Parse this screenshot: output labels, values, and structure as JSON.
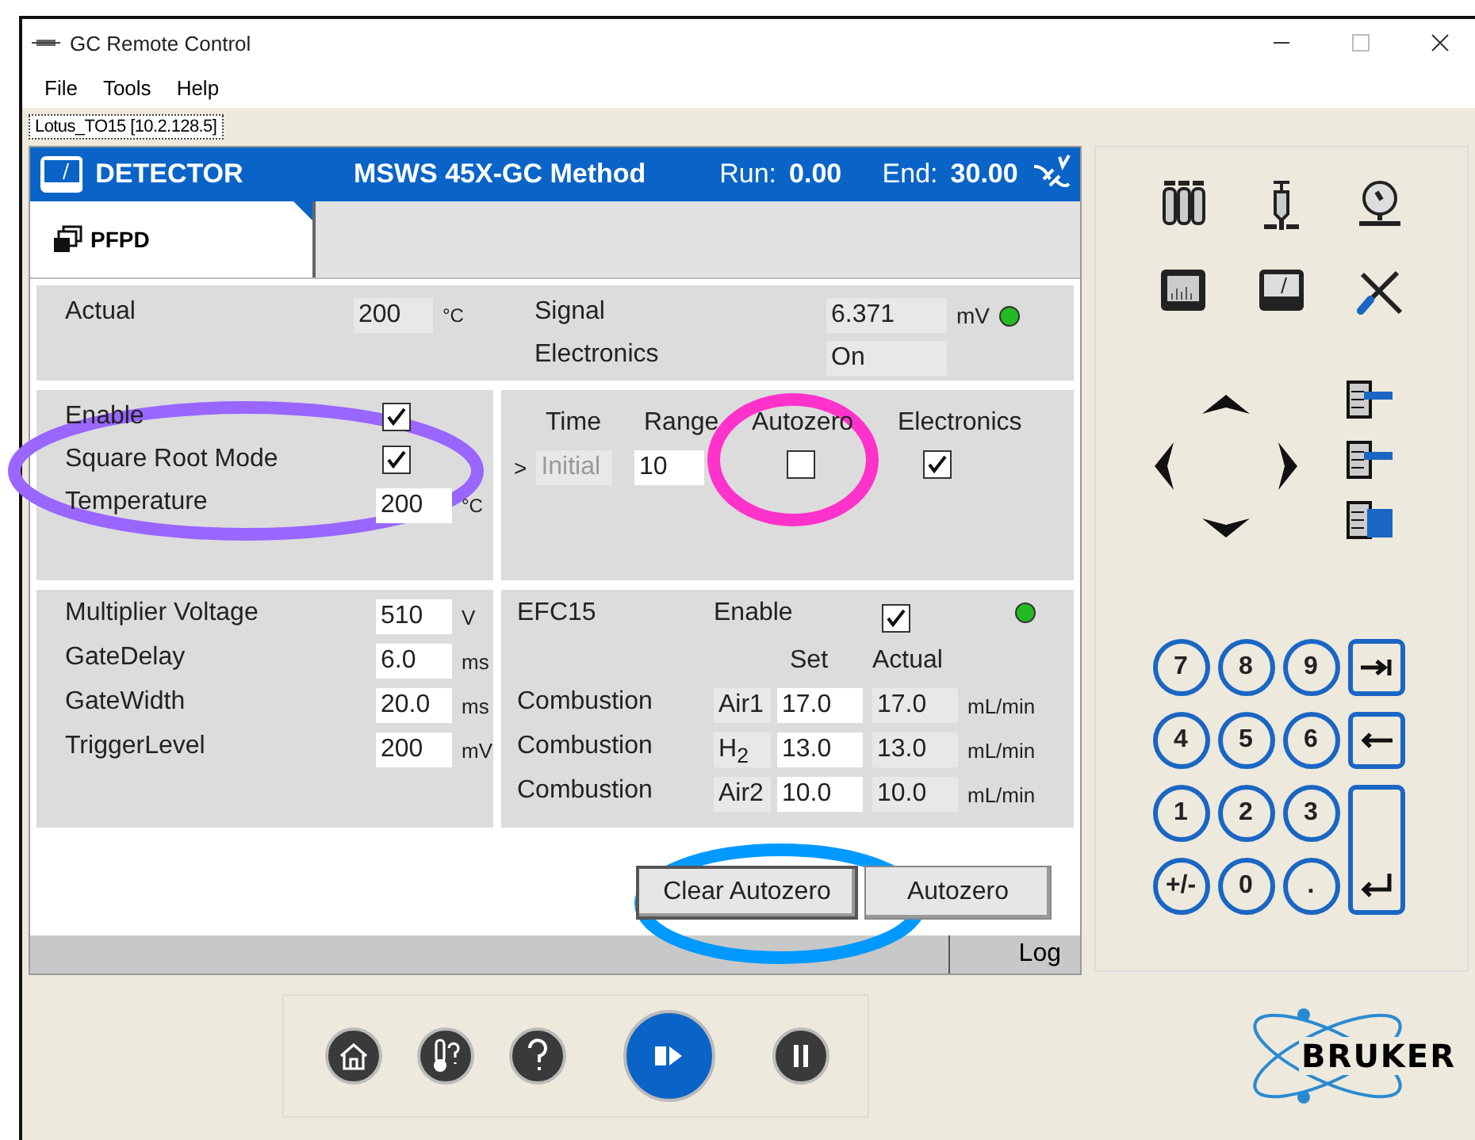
{
  "window": {
    "title": "GC Remote Control"
  },
  "menu": [
    "File",
    "Tools",
    "Help"
  ],
  "connection_tab": "Lotus_TO15 [10.2.128.5]",
  "header": {
    "module": "DETECTOR",
    "method": "MSWS 45X-GC Method",
    "run_label": "Run:",
    "run": "0.00",
    "end_label": "End:",
    "end": "30.00"
  },
  "tabs": [
    {
      "label": "PFPD",
      "selected": true
    }
  ],
  "status": {
    "actual_label": "Actual",
    "actual": "200",
    "actual_unit": "°C",
    "signal_label": "Signal",
    "signal": "6.371",
    "signal_unit": "mV",
    "signal_ok": true,
    "electronics_label": "Electronics",
    "electronics": "On"
  },
  "settings": [
    {
      "kind": "checkbox",
      "label": "Enable",
      "checked": true
    },
    {
      "kind": "checkbox",
      "label": "Square Root Mode",
      "checked": true
    },
    {
      "kind": "input",
      "label": "Temperature",
      "value": "200",
      "unit": "°C"
    }
  ],
  "timetable": {
    "columns": [
      "Time",
      "Range",
      "Autozero",
      "Electronics"
    ],
    "row": {
      "marker": ">",
      "time": "Initial",
      "range": "10",
      "autozero": false,
      "electronics": true
    }
  },
  "params": [
    {
      "label": "Multiplier Voltage",
      "value": "510",
      "unit": "V"
    },
    {
      "label": "GateDelay",
      "value": "6.0",
      "unit": "ms"
    },
    {
      "label": "GateWidth",
      "value": "20.0",
      "unit": "ms"
    },
    {
      "label": "TriggerLevel",
      "value": "200",
      "unit": "mV"
    }
  ],
  "efc": {
    "title": "EFC15",
    "enable_label": "Enable",
    "enabled": true,
    "color": "#22bb22",
    "columns": [
      "Set",
      "Actual"
    ],
    "rows": [
      {
        "label": "Combustion",
        "gas": "Air1",
        "set": "17.0",
        "actual": "17.0",
        "unit": "mL/min"
      },
      {
        "label": "Combustion",
        "gas": "H$_{2}$",
        "set": "13.0",
        "actual": "13.0",
        "unit": "mL/min"
      },
      {
        "label": "Combustion",
        "gas": "Air2",
        "set": "10.0",
        "actual": "10.0",
        "unit": "mL/min"
      }
    ]
  },
  "buttons": [
    {
      "label": "Clear Autozero",
      "focused": true
    },
    {
      "label": "Autozero",
      "focused": false
    }
  ],
  "status_bar": {
    "log": "Log"
  },
  "keypad": [
    {
      "kind": "key",
      "label": "7"
    },
    {
      "kind": "key",
      "label": "8"
    },
    {
      "kind": "key",
      "label": "9"
    },
    {
      "kind": "tab"
    },
    {
      "kind": "key",
      "label": "4"
    },
    {
      "kind": "key",
      "label": "5"
    },
    {
      "kind": "key",
      "label": "6"
    },
    {
      "kind": "backspace"
    },
    {
      "kind": "key",
      "label": "1"
    },
    {
      "kind": "key",
      "label": "2"
    },
    {
      "kind": "key",
      "label": "3"
    },
    {
      "kind": "enter"
    },
    {
      "kind": "key",
      "label": "+/-"
    },
    {
      "kind": "key",
      "label": "0"
    },
    {
      "kind": "key",
      "label": "."
    }
  ],
  "brand": "BRUKER",
  "annotations": [
    {
      "color": "#9966ff"
    },
    {
      "color": "#ff33cc"
    },
    {
      "color": "#0099ff"
    }
  ]
}
